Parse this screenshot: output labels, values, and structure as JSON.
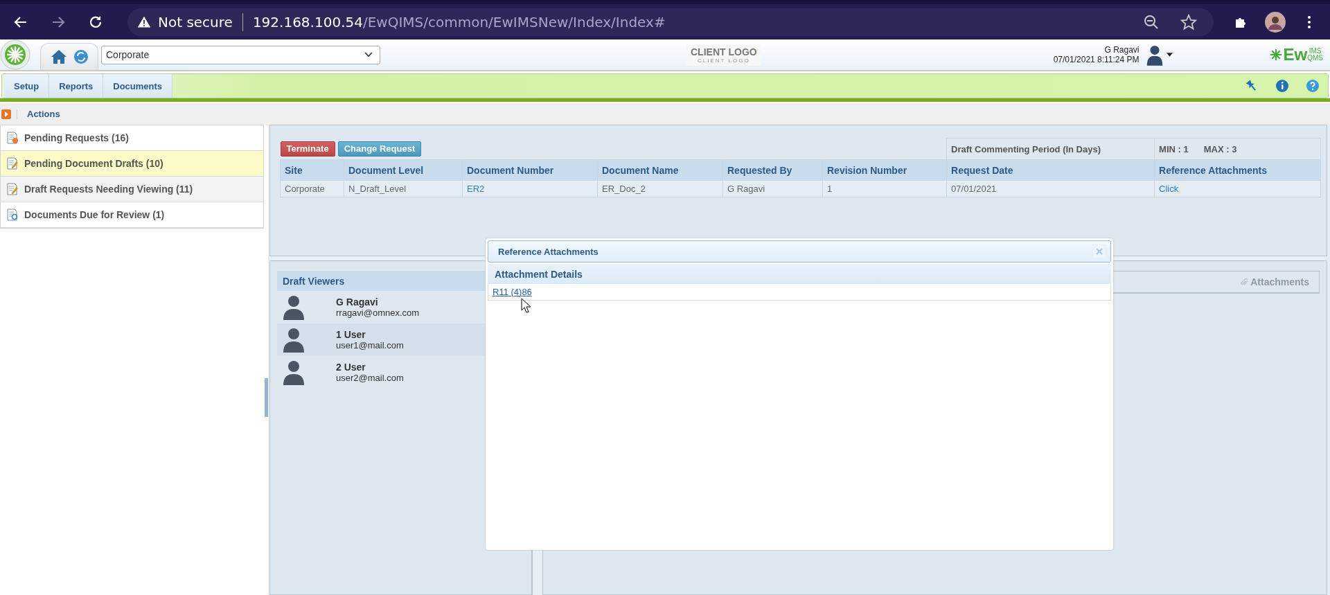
{
  "browser": {
    "security_label": "Not secure",
    "url_host": "192.168.100.54",
    "url_path": "/EwQIMS/common/EwIMSNew/Index/Index#"
  },
  "header": {
    "site_select": {
      "value": "Corporate"
    },
    "client_logo": {
      "title": "CLIENT LOGO",
      "subtitle": "CLIENT LOGO"
    },
    "user": {
      "name": "G Ragavi",
      "datetime": "07/01/2021 8:11:24 PM"
    },
    "brand": {
      "main": "Ew",
      "top": "IMS",
      "bottom": "QMS"
    }
  },
  "nav_tabs": [
    {
      "label": "Setup"
    },
    {
      "label": "Reports"
    },
    {
      "label": "Documents"
    }
  ],
  "breadcrumb": {
    "label": "Actions"
  },
  "action_list": [
    {
      "label": "Pending Requests (16)",
      "selected": false,
      "hovered": false
    },
    {
      "label": "Pending Document Drafts (10)",
      "selected": true,
      "hovered": false
    },
    {
      "label": "Draft Requests Needing Viewing (11)",
      "selected": false,
      "hovered": true
    },
    {
      "label": "Documents Due for Review (1)",
      "selected": false,
      "hovered": false
    }
  ],
  "toolbar": {
    "buttons": [
      {
        "label": "Terminate",
        "kind": "danger"
      },
      {
        "label": "Change Request",
        "kind": "info"
      }
    ],
    "commenting_label": "Draft Commenting Period (In Days)",
    "min": "MIN : 1",
    "max": "MAX : 3"
  },
  "table": {
    "columns": [
      "Site",
      "Document Level",
      "Document Number",
      "Document Name",
      "Requested By",
      "Revision Number",
      "Request Date",
      "Reference Attachments"
    ],
    "rows": [
      [
        {
          "text": "Corporate",
          "kind": "text"
        },
        {
          "text": "N_Draft_Level",
          "kind": "text"
        },
        {
          "text": "ER2",
          "kind": "link"
        },
        {
          "text": "ER_Doc_2",
          "kind": "text"
        },
        {
          "text": "G Ragavi",
          "kind": "text"
        },
        {
          "text": "1",
          "kind": "text"
        },
        {
          "text": "07/01/2021",
          "kind": "text"
        },
        {
          "text": "Click",
          "kind": "link"
        }
      ]
    ]
  },
  "draft_viewers": {
    "title": "Draft Viewers",
    "users": [
      {
        "name": "G Ragavi",
        "email": "rragavi@omnex.com"
      },
      {
        "name": "1 User",
        "email": "user1@mail.com"
      },
      {
        "name": "2 User",
        "email": "user2@mail.com"
      }
    ]
  },
  "attachments_panel": {
    "title": "Attachments"
  },
  "dialog": {
    "title": "Reference Attachments",
    "section": "Attachment Details",
    "attachments": [
      "R11 (4)86"
    ]
  }
}
